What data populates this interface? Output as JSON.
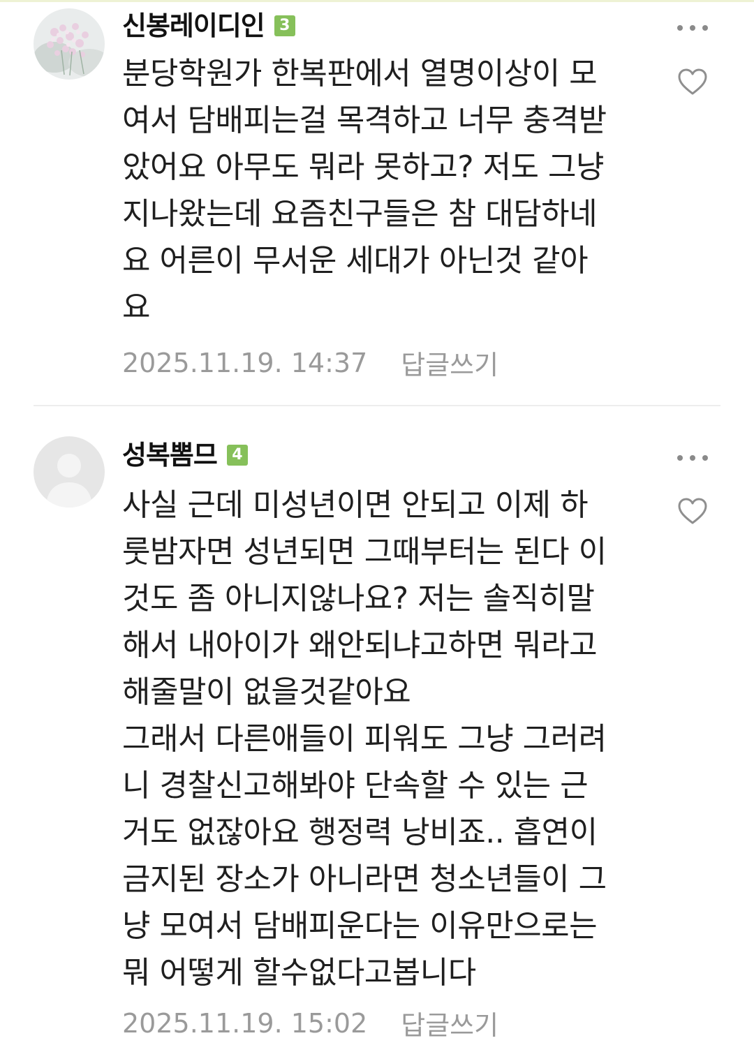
{
  "comments": [
    {
      "author": "신봉레이디인",
      "level": "3",
      "text": "분당학원가 한복판에서 열명이상이 모\n여서 담배피는걸 목격하고 너무 충격받\n았어요 아무도 뭐라 못하고? 저도 그냥\n지나왔는데 요즘친구들은 참 대담하네\n요 어른이 무서운 세대가 아닌것 같아\n요",
      "date": "2025.11.19. 14:37",
      "reply_label": "답글쓰기",
      "avatar_icon": "flower-photo-avatar"
    },
    {
      "author": "성복뽐므",
      "level": "4",
      "text": "사실 근데 미성년이면 안되고 이제 하\n룻밤자면 성년되면 그때부터는 된다 이\n것도 좀 아니지않나요? 저는 솔직히말\n해서 내아이가 왜안되냐고하면 뭐라고\n해줄말이 없을것같아요\n그래서 다른애들이 피워도 그냥 그러려\n니 경찰신고해봐야 단속할 수 있는 근\n거도 없잖아요 행정력 낭비죠.. 흡연이\n금지된 장소가 아니라면 청소년들이 그\n냥 모여서 담배피운다는 이유만으로는\n뭐 어떻게 할수없다고봅니다",
      "date": "2025.11.19. 15:02",
      "reply_label": "답글쓰기",
      "avatar_icon": "default-person-avatar"
    }
  ],
  "colors": {
    "level_badge": "#86c05a",
    "meta_text": "#9a9a9a",
    "divider": "#ededed"
  }
}
